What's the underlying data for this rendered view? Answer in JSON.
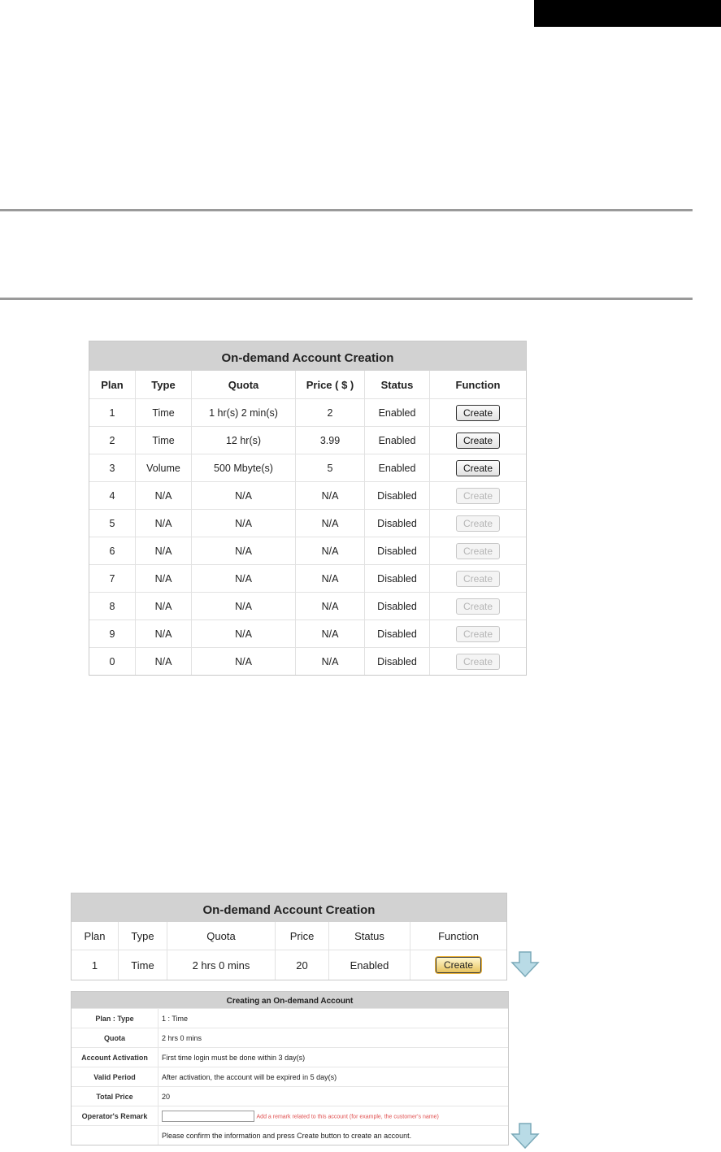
{
  "table1": {
    "title": "On-demand Account Creation",
    "headers": [
      "Plan",
      "Type",
      "Quota",
      "Price ( $ )",
      "Status",
      "Function"
    ],
    "rows": [
      {
        "plan": "1",
        "type": "Time",
        "quota": "1 hr(s) 2 min(s)",
        "price": "2",
        "status": "Enabled",
        "button": "Create",
        "enabled": true
      },
      {
        "plan": "2",
        "type": "Time",
        "quota": "12 hr(s)",
        "price": "3.99",
        "status": "Enabled",
        "button": "Create",
        "enabled": true
      },
      {
        "plan": "3",
        "type": "Volume",
        "quota": "500 Mbyte(s)",
        "price": "5",
        "status": "Enabled",
        "button": "Create",
        "enabled": true
      },
      {
        "plan": "4",
        "type": "N/A",
        "quota": "N/A",
        "price": "N/A",
        "status": "Disabled",
        "button": "Create",
        "enabled": false
      },
      {
        "plan": "5",
        "type": "N/A",
        "quota": "N/A",
        "price": "N/A",
        "status": "Disabled",
        "button": "Create",
        "enabled": false
      },
      {
        "plan": "6",
        "type": "N/A",
        "quota": "N/A",
        "price": "N/A",
        "status": "Disabled",
        "button": "Create",
        "enabled": false
      },
      {
        "plan": "7",
        "type": "N/A",
        "quota": "N/A",
        "price": "N/A",
        "status": "Disabled",
        "button": "Create",
        "enabled": false
      },
      {
        "plan": "8",
        "type": "N/A",
        "quota": "N/A",
        "price": "N/A",
        "status": "Disabled",
        "button": "Create",
        "enabled": false
      },
      {
        "plan": "9",
        "type": "N/A",
        "quota": "N/A",
        "price": "N/A",
        "status": "Disabled",
        "button": "Create",
        "enabled": false
      },
      {
        "plan": "0",
        "type": "N/A",
        "quota": "N/A",
        "price": "N/A",
        "status": "Disabled",
        "button": "Create",
        "enabled": false
      }
    ]
  },
  "table2": {
    "title": "On-demand Account Creation",
    "headers": [
      "Plan",
      "Type",
      "Quota",
      "Price",
      "Status",
      "Function"
    ],
    "row": {
      "plan": "1",
      "type": "Time",
      "quota": "2 hrs 0 mins",
      "price": "20",
      "status": "Enabled",
      "button": "Create"
    }
  },
  "table3": {
    "title": "Creating an On-demand Account",
    "rows": [
      {
        "label": "Plan : Type",
        "value": "1 : Time"
      },
      {
        "label": "Quota",
        "value": "2 hrs 0 mins"
      },
      {
        "label": "Account Activation",
        "value": "First time login must be done within 3 day(s)"
      },
      {
        "label": "Valid Period",
        "value": "After activation, the account will be expired in 5 day(s)"
      },
      {
        "label": "Total Price",
        "value": "20"
      }
    ],
    "remark_label": "Operator's Remark",
    "remark_value": "",
    "remark_hint": "Add a remark related to this account (for example, the customer's name)",
    "confirm_text": "Please confirm the information and press Create button to create an account."
  },
  "colors": {
    "header_bg": "#d2d2d2",
    "arrow_fill": "#b9dbe6",
    "arrow_stroke": "#7aa9b8",
    "hint": "#e05050"
  }
}
